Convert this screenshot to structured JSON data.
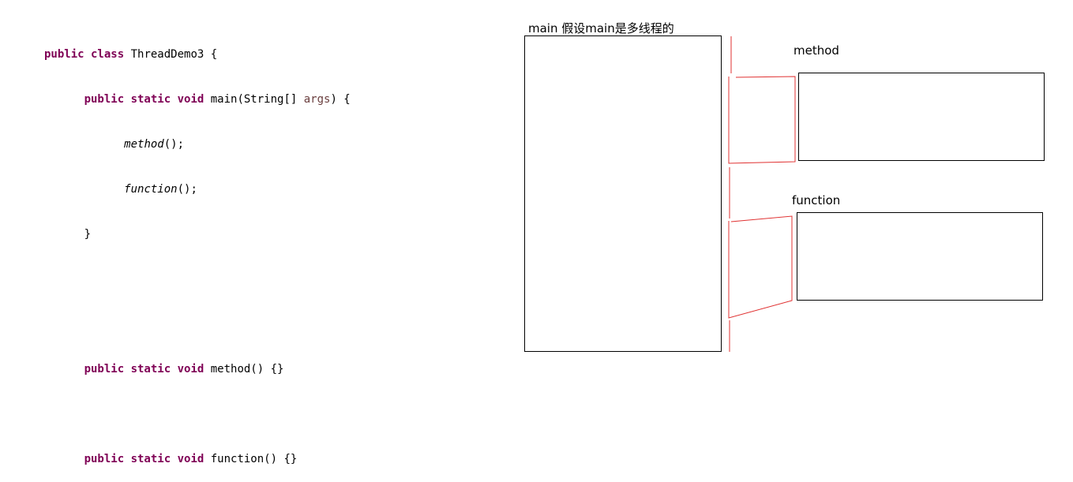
{
  "code": {
    "line1": {
      "kw": "public class",
      "rest": " ThreadDemo3 {"
    },
    "line2": {
      "kw": "public static void",
      "pre": " main(String[] ",
      "param": "args",
      "post": ") {"
    },
    "line3": {
      "call": "method",
      "tail": "();"
    },
    "line4": {
      "call": "function",
      "tail": "();"
    },
    "line5": {
      "brace": "}"
    },
    "line6": {
      "kw": "public static void",
      "rest": " method() {}"
    },
    "line7": {
      "kw": "public static void",
      "rest": " function() {}"
    }
  },
  "diagram": {
    "main_label": "main 假设main是多线程的",
    "method_label": "method",
    "function_label": "function",
    "line_color": "#e03030",
    "box_color": "#000000"
  }
}
